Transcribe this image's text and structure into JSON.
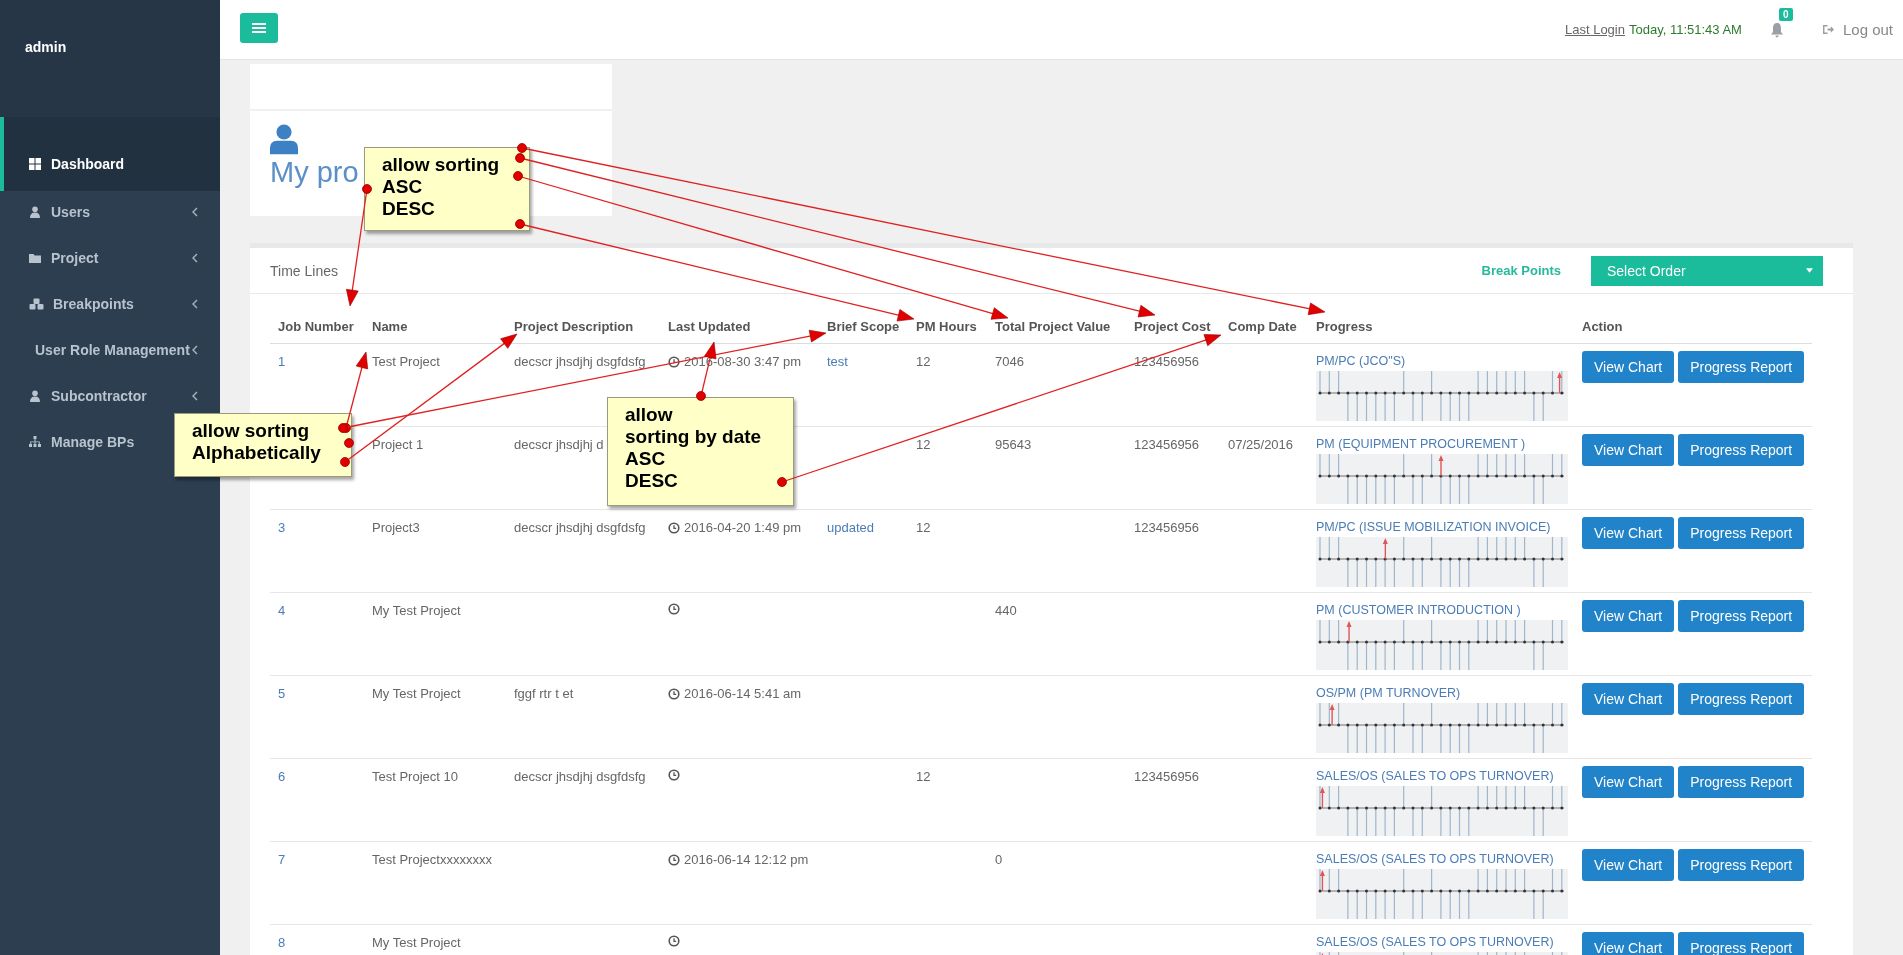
{
  "sidebar": {
    "user": "admin",
    "items": [
      {
        "label": "Dashboard",
        "selected": true,
        "expandable": false
      },
      {
        "label": "Users",
        "selected": false,
        "expandable": true
      },
      {
        "label": "Project",
        "selected": false,
        "expandable": true
      },
      {
        "label": "Breakpoints",
        "selected": false,
        "expandable": true
      },
      {
        "label": "User Role Management",
        "selected": false,
        "expandable": true
      },
      {
        "label": "Subcontractor",
        "selected": false,
        "expandable": true
      },
      {
        "label": "Manage BPs",
        "selected": false,
        "expandable": false
      }
    ]
  },
  "topbar": {
    "last_login_label": "Last Login",
    "last_login_value": "Today, 11:51:43 AM",
    "notifications": "0",
    "logout": "Log out"
  },
  "profile_card": {
    "title": "My pro"
  },
  "timelines": {
    "title": "Time Lines",
    "break_points_label": "Break Points",
    "order_select": "Select Order"
  },
  "table": {
    "columns": [
      "Job Number",
      "Name",
      "Project Description",
      "Last Updated",
      "Brief Scope",
      "PM Hours",
      "Total Project Value",
      "Project Cost",
      "Comp Date",
      "Progress",
      "Action"
    ],
    "rows": [
      {
        "job": "1",
        "name": "Test Project",
        "description": "decscr jhsdjhj dsgfdsfg",
        "clock": true,
        "last_updated": "2016-08-30 3:47 pm",
        "brief_scope": "test",
        "pm_hours": "12",
        "total_value": "7046",
        "cost": "123456956",
        "progress": {
          "stage": "PM/PC (JCO\"S)",
          "level": 0.99
        },
        "actions": [
          "View Chart",
          "Progress Report"
        ]
      },
      {
        "name": "Project 1",
        "description": "decscr jhsdjhj d",
        "pm_hours": "12",
        "total_value": "95643",
        "cost": "123456956",
        "comp_date": "07/25/2016",
        "progress": {
          "stage": "PM (EQUIPMENT PROCUREMENT )",
          "level": 0.5
        },
        "actions": [
          "View Chart",
          "Progress Report"
        ]
      },
      {
        "job": "3",
        "name": "Project3",
        "description": "decscr jhsdjhj dsgfdsfg",
        "clock": true,
        "last_updated": "2016-04-20 1:49 pm",
        "brief_scope": "updated",
        "pm_hours": "12",
        "cost": "123456956",
        "progress": {
          "stage": "PM/PC (ISSUE MOBILIZATION INVOICE)",
          "level": 0.27
        },
        "actions": [
          "View Chart",
          "Progress Report"
        ]
      },
      {
        "job": "4",
        "name": "My Test Project",
        "clock": true,
        "total_value": "440",
        "progress": {
          "stage": "PM (CUSTOMER INTRODUCTION )",
          "level": 0.12
        },
        "actions": [
          "View Chart",
          "Progress Report"
        ]
      },
      {
        "job": "5",
        "name": "My Test Project",
        "description": "fggf rtr t et",
        "clock": true,
        "last_updated": "2016-06-14 5:41 am",
        "progress": {
          "stage": "OS/PM (PM TURNOVER)",
          "level": 0.05
        },
        "actions": [
          "View Chart",
          "Progress Report"
        ]
      },
      {
        "job": "6",
        "name": "Test Project 10",
        "description": "decscr jhsdjhj dsgfdsfg",
        "clock": true,
        "pm_hours": "12",
        "cost": "123456956",
        "progress": {
          "stage": "SALES/OS (SALES TO OPS TURNOVER)",
          "level": 0.01
        },
        "actions": [
          "View Chart",
          "Progress Report"
        ]
      },
      {
        "job": "7",
        "name": "Test Projectxxxxxxxx",
        "clock": true,
        "last_updated": "2016-06-14 12:12 pm",
        "total_value": "0",
        "progress": {
          "stage": "SALES/OS (SALES TO OPS TURNOVER)",
          "level": 0.01
        },
        "actions": [
          "View Chart",
          "Progress Report"
        ]
      },
      {
        "job": "8",
        "name": "My Test Project",
        "clock": true,
        "progress": {
          "stage": "SALES/OS (SALES TO OPS TURNOVER)",
          "level": 0.01
        },
        "actions": [
          "View Chart",
          "Progress Report"
        ]
      }
    ]
  },
  "annotations": [
    {
      "text": "allow sorting\nASC\nDESC"
    },
    {
      "text": "allow sorting\nAlphabetically"
    },
    {
      "text": "allow\nsorting by date\nASC\nDESC"
    }
  ]
}
